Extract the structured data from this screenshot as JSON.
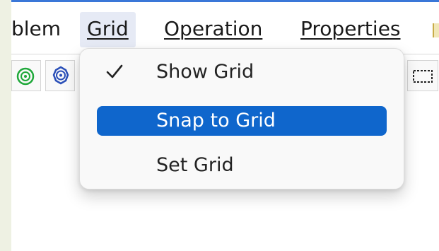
{
  "menubar": {
    "items": [
      {
        "label": "blem"
      },
      {
        "label": "Grid",
        "open": true
      },
      {
        "label": "Operation"
      },
      {
        "label": "Properties"
      }
    ]
  },
  "grid_menu": {
    "items": [
      {
        "label": "Show Grid",
        "checked": true,
        "highlighted": false
      },
      {
        "label": "Snap to Grid",
        "checked": false,
        "highlighted": true
      },
      {
        "label": "Set Grid",
        "checked": false,
        "highlighted": false
      }
    ]
  },
  "toolbar": {
    "buttons": [
      {
        "icon": "green-node-icon"
      },
      {
        "icon": "blue-gear-node-icon"
      },
      {
        "icon": "dashed-selection-icon"
      }
    ]
  },
  "colors": {
    "menu_highlight": "#0f66cc",
    "top_border": "#3a77d8",
    "left_strip": "#eef1e3",
    "open_menu_bg": "#e6eaf5"
  }
}
